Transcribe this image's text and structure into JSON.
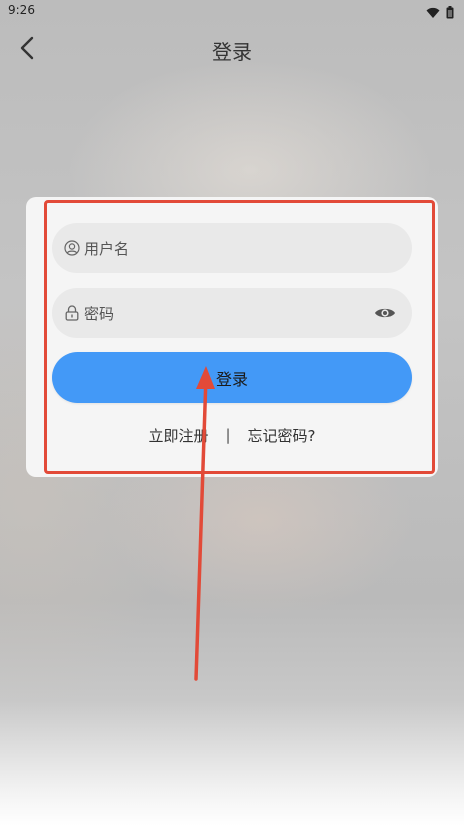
{
  "status_bar": {
    "time": "9:26",
    "icons": [
      "wifi-icon",
      "battery-icon"
    ]
  },
  "header": {
    "title": "登录",
    "back_icon": "chevron-left-icon"
  },
  "login_form": {
    "username": {
      "placeholder": "用户名",
      "value": "",
      "icon": "user-icon"
    },
    "password": {
      "placeholder": "密码",
      "value": "",
      "icon": "lock-icon",
      "toggle_icon": "eye-icon"
    },
    "submit_label": "登录",
    "register_link": "立即注册",
    "separator": "|",
    "forgot_link": "忘记密码?"
  },
  "annotation": {
    "highlight_color": "#e24a38",
    "arrow_color": "#e24a38"
  },
  "colors": {
    "primary_button": "#4399f7",
    "card_background": "#f5f5f5",
    "input_background": "#e9e9e9"
  }
}
